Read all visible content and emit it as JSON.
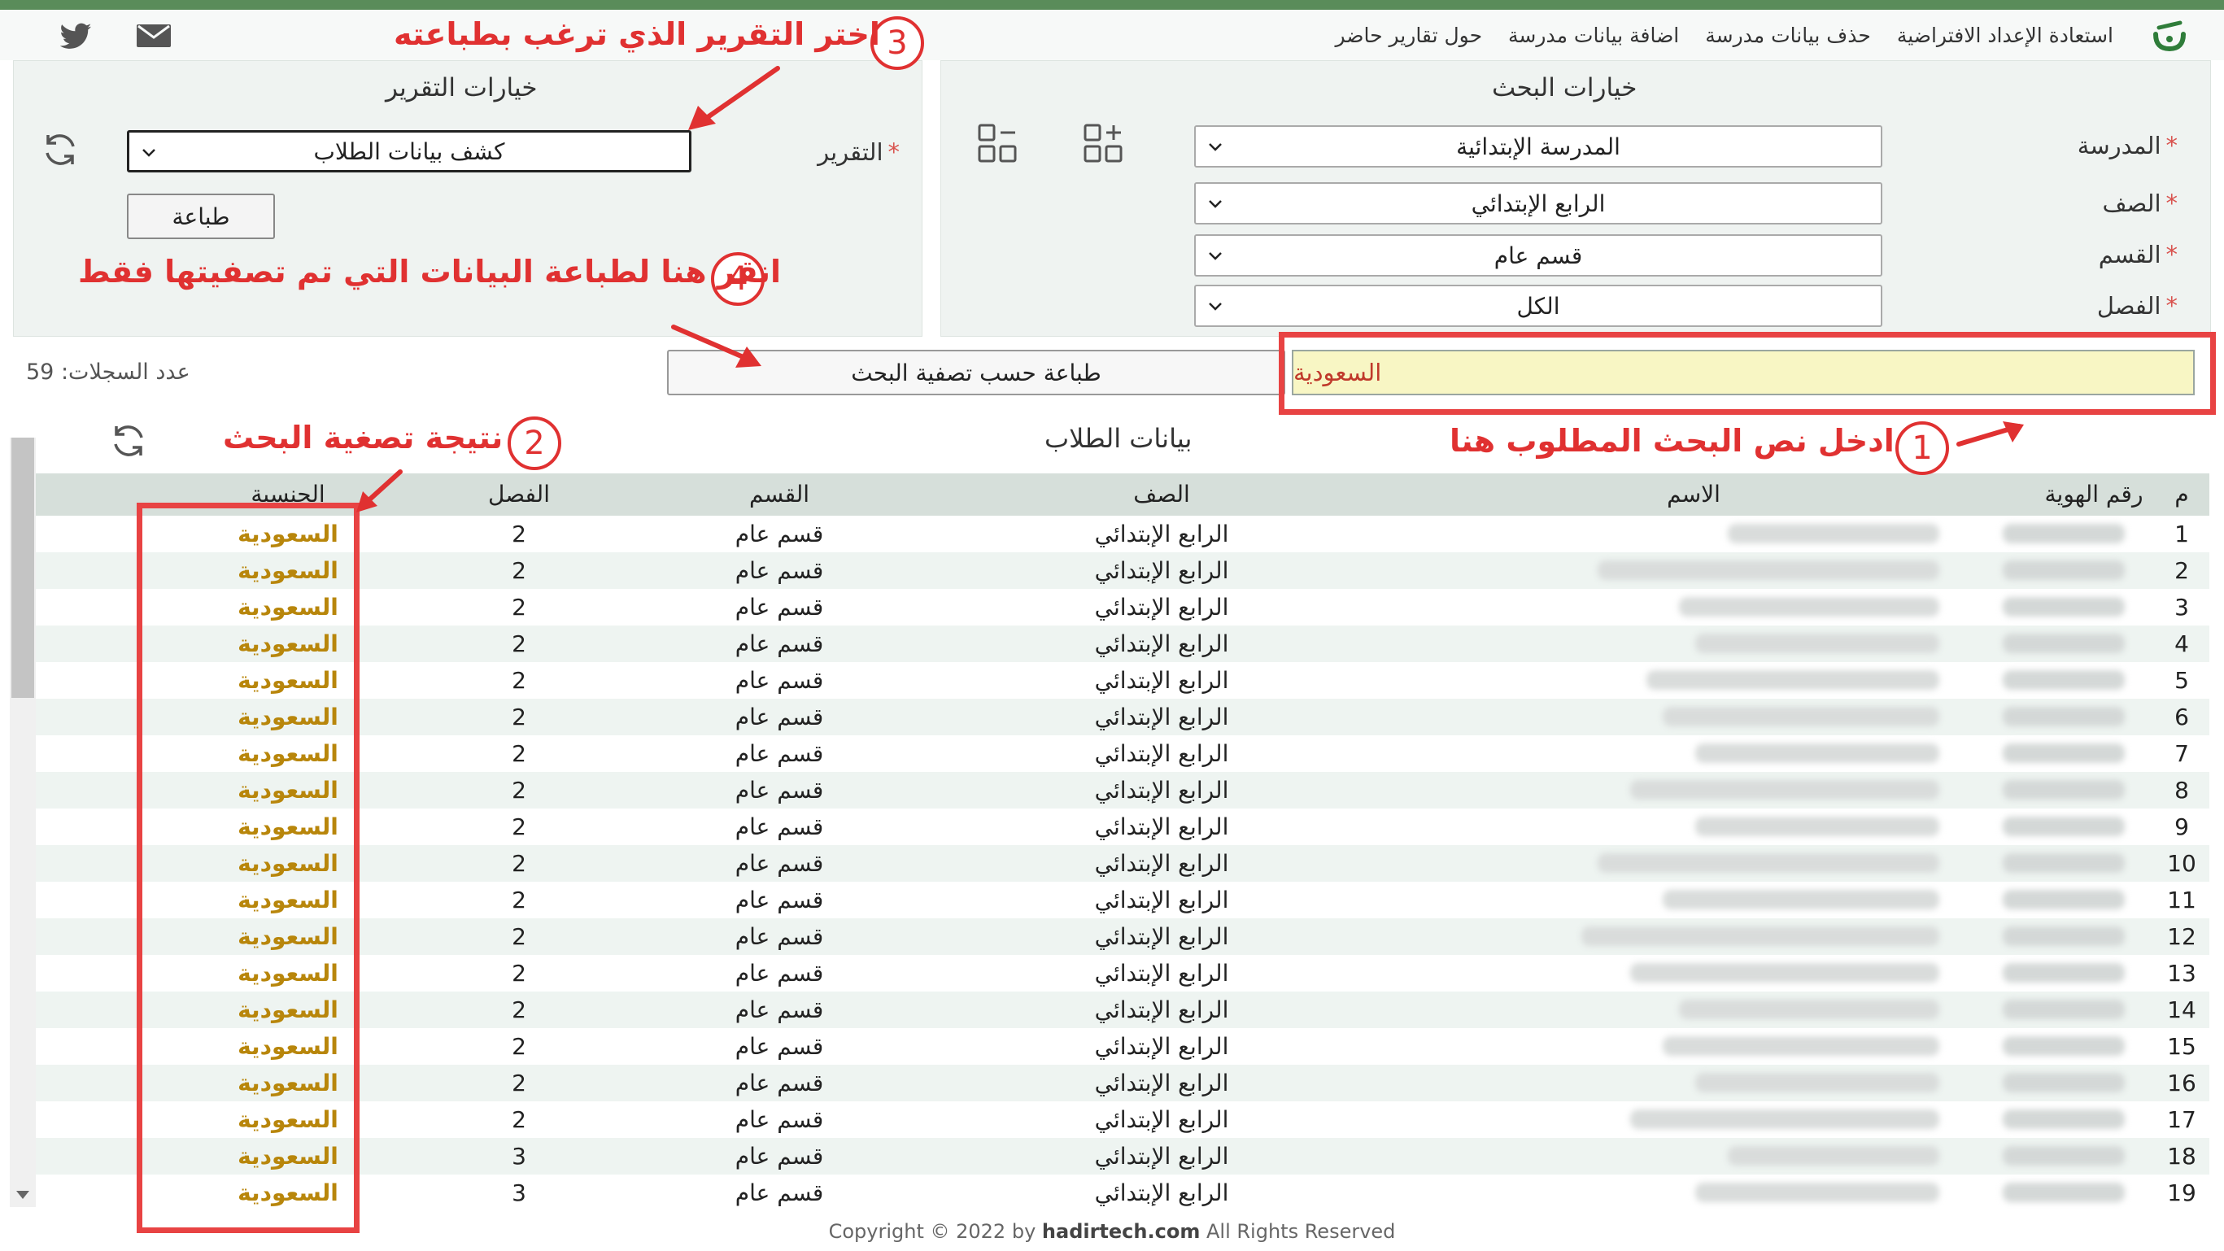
{
  "menu": {
    "items": [
      "حول تقارير حاضر",
      "اضافة بيانات مدرسة",
      "حذف بيانات مدرسة",
      "استعادة الإعداد الافتراضية"
    ]
  },
  "search_options": {
    "title": "خيارات البحث",
    "school_label": "المدرسة",
    "school_value": "المدرسة الإبتدائية",
    "grade_label": "الصف",
    "grade_value": "الرابع الإبتدائي",
    "section_label": "القسم",
    "section_value": "قسم عام",
    "class_label": "الفصل",
    "class_value": "الكل"
  },
  "report_options": {
    "title": "خيارات التقرير",
    "report_label": "التقرير",
    "report_value": "كشف بيانات الطلاب",
    "print_label": "طباعة"
  },
  "filter": {
    "search_value": "السعودية",
    "print_filtered_label": "طباعة حسب تصفية البحث",
    "records_count_label": "عدد السجلات: 59"
  },
  "annotations": {
    "a1_number": "1",
    "a1_text": "ادخل نص البحث المطلوب هنا",
    "a2_number": "2",
    "a2_text": "نتيجة تصغية البحث",
    "a3_number": "3",
    "a3_text": "اختر التقرير الذي ترغب بطباعته",
    "a4_number": "4",
    "a4_text": "انقر هنا لطباعة البيانات التي تم تصفيتها فقط"
  },
  "table": {
    "title": "بيانات الطلاب",
    "headers": [
      "م",
      "رقم الهوية",
      "الاسم",
      "الصف",
      "القسم",
      "الفصل",
      "الجنسية"
    ],
    "rows": [
      {
        "n": "1",
        "grade": "الرابع الإبتدائي",
        "section": "قسم عام",
        "class": "2",
        "nationality": "السعودية"
      },
      {
        "n": "2",
        "grade": "الرابع الإبتدائي",
        "section": "قسم عام",
        "class": "2",
        "nationality": "السعودية"
      },
      {
        "n": "3",
        "grade": "الرابع الإبتدائي",
        "section": "قسم عام",
        "class": "2",
        "nationality": "السعودية"
      },
      {
        "n": "4",
        "grade": "الرابع الإبتدائي",
        "section": "قسم عام",
        "class": "2",
        "nationality": "السعودية"
      },
      {
        "n": "5",
        "grade": "الرابع الإبتدائي",
        "section": "قسم عام",
        "class": "2",
        "nationality": "السعودية"
      },
      {
        "n": "6",
        "grade": "الرابع الإبتدائي",
        "section": "قسم عام",
        "class": "2",
        "nationality": "السعودية"
      },
      {
        "n": "7",
        "grade": "الرابع الإبتدائي",
        "section": "قسم عام",
        "class": "2",
        "nationality": "السعودية"
      },
      {
        "n": "8",
        "grade": "الرابع الإبتدائي",
        "section": "قسم عام",
        "class": "2",
        "nationality": "السعودية"
      },
      {
        "n": "9",
        "grade": "الرابع الإبتدائي",
        "section": "قسم عام",
        "class": "2",
        "nationality": "السعودية"
      },
      {
        "n": "10",
        "grade": "الرابع الإبتدائي",
        "section": "قسم عام",
        "class": "2",
        "nationality": "السعودية"
      },
      {
        "n": "11",
        "grade": "الرابع الإبتدائي",
        "section": "قسم عام",
        "class": "2",
        "nationality": "السعودية"
      },
      {
        "n": "12",
        "grade": "الرابع الإبتدائي",
        "section": "قسم عام",
        "class": "2",
        "nationality": "السعودية"
      },
      {
        "n": "13",
        "grade": "الرابع الإبتدائي",
        "section": "قسم عام",
        "class": "2",
        "nationality": "السعودية"
      },
      {
        "n": "14",
        "grade": "الرابع الإبتدائي",
        "section": "قسم عام",
        "class": "2",
        "nationality": "السعودية"
      },
      {
        "n": "15",
        "grade": "الرابع الإبتدائي",
        "section": "قسم عام",
        "class": "2",
        "nationality": "السعودية"
      },
      {
        "n": "16",
        "grade": "الرابع الإبتدائي",
        "section": "قسم عام",
        "class": "2",
        "nationality": "السعودية"
      },
      {
        "n": "17",
        "grade": "الرابع الإبتدائي",
        "section": "قسم عام",
        "class": "2",
        "nationality": "السعودية"
      },
      {
        "n": "18",
        "grade": "الرابع الإبتدائي",
        "section": "قسم عام",
        "class": "3",
        "nationality": "السعودية"
      },
      {
        "n": "19",
        "grade": "الرابع الإبتدائي",
        "section": "قسم عام",
        "class": "3",
        "nationality": "السعودية"
      }
    ]
  },
  "footer": {
    "prefix": "Copyright © 2022 by",
    "brand": "hadirtech.com",
    "suffix": "All Rights Reserved"
  },
  "colors": {
    "accent_green": "#5a8c5a",
    "annotation_red": "#e03131",
    "nationality_gold": "#b8860b",
    "search_bg": "#f8f6c4"
  },
  "icons": [
    "app-logo-icon",
    "twitter-icon",
    "mail-icon",
    "collapse-grid-icon",
    "expand-grid-icon",
    "refresh-icon",
    "chevron-down-icon"
  ]
}
